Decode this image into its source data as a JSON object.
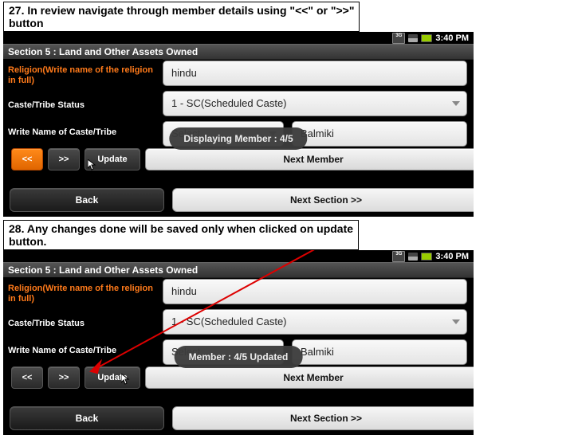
{
  "instructions": {
    "step27_line1": "27. In review navigate through member details using \"<<\" or \">>\"",
    "step27_line2": "button",
    "step28_line1": "28. Any changes done will be saved only when clicked on update",
    "step28_line2": "button."
  },
  "statusbar": {
    "net_label": "3G",
    "time": "3:40 PM"
  },
  "section_header": "Section 5  : Land and Other Assets Owned",
  "labels": {
    "religion": "Religion(Write name of the religion in full)",
    "caste_status": "Caste/Tribe Status",
    "tribe_name": "Write Name of Caste/Tribe"
  },
  "fields": {
    "religion_value": "hindu",
    "caste_status_value": "1 - SC(Scheduled Caste)",
    "tribe_select": "Select",
    "tribe_text": "Balmiki"
  },
  "nav": {
    "prev": "<<",
    "next": ">>",
    "update": "Update",
    "next_member": "Next Member"
  },
  "bottom": {
    "back": "Back",
    "next_section": "Next Section >>"
  },
  "toast": {
    "displaying": "Displaying Member : 4/5",
    "updated": "Member : 4/5 Updated"
  }
}
